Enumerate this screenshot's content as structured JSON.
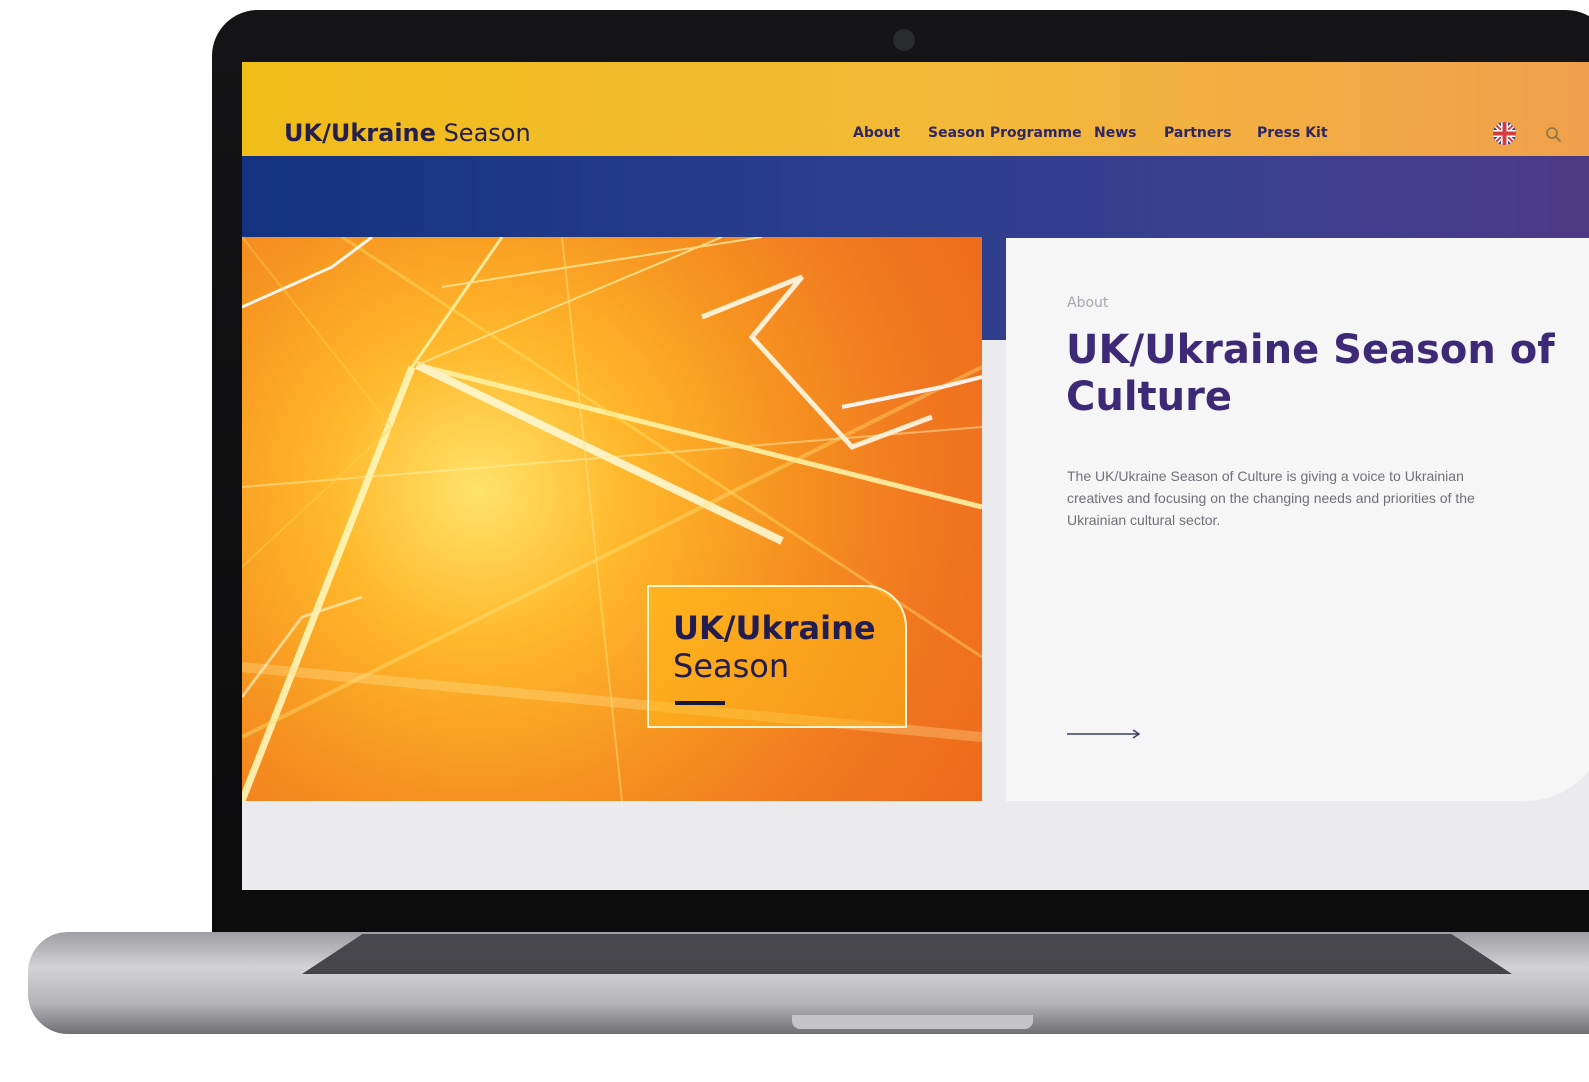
{
  "header": {
    "logo_bold": "UK/Ukraine",
    "logo_light": "Season",
    "nav": [
      {
        "label": "About"
      },
      {
        "label": "Season Programme"
      },
      {
        "label": "News"
      },
      {
        "label": "Partners"
      },
      {
        "label": "Press Kit"
      }
    ],
    "language_icon": "uk-flag-icon",
    "search_icon": "search-icon"
  },
  "hero": {
    "badge_line1": "UK/Ukraine",
    "badge_line2": "Season"
  },
  "card": {
    "kicker": "About",
    "title": "UK/Ukraine Season of Culture",
    "description": "The UK/Ukraine Season of Culture is giving a voice to Ukrainian creatives and focusing on the changing needs and priorities of the Ukrainian cultural sector.",
    "arrow_icon": "arrow-right-icon"
  },
  "colors": {
    "header_yellow": "#f1bd18",
    "header_orange": "#f0a04c",
    "brand_navy": "#13327f",
    "title_purple": "#3d2a76",
    "hero_orange": "#f17720"
  }
}
